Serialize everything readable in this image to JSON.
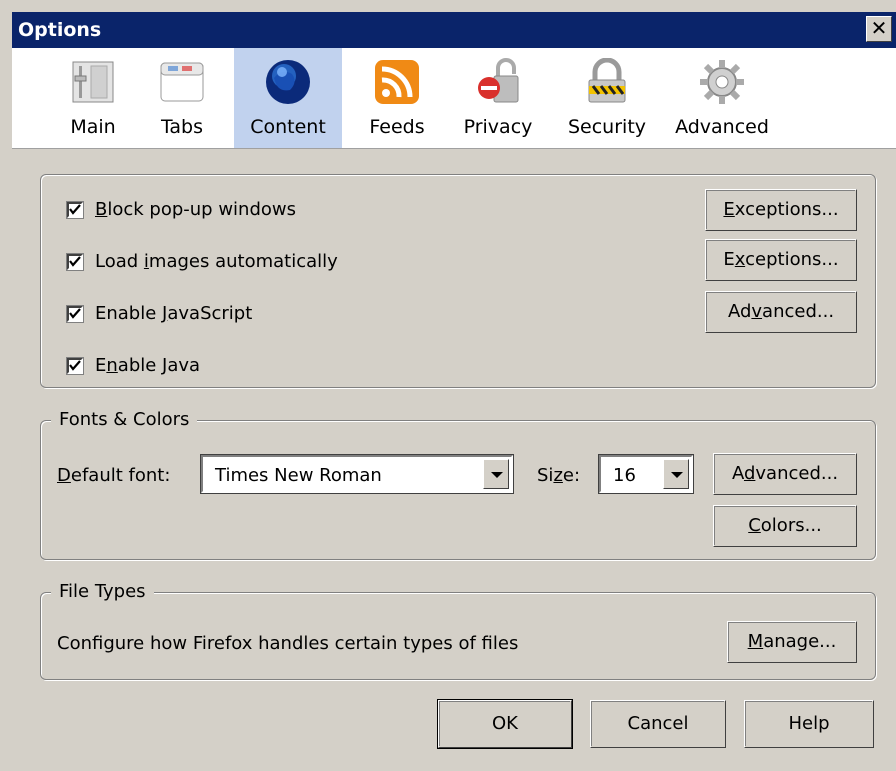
{
  "window": {
    "title": "Options",
    "close_glyph": "✕"
  },
  "toolbar": {
    "tabs": [
      {
        "label": "Main",
        "icon": "main-sliders-icon"
      },
      {
        "label": "Tabs",
        "icon": "tabs-window-icon"
      },
      {
        "label": "Content",
        "icon": "content-globe-icon",
        "selected": true
      },
      {
        "label": "Feeds",
        "icon": "feeds-rss-icon"
      },
      {
        "label": "Privacy",
        "icon": "privacy-lock-icon"
      },
      {
        "label": "Security",
        "icon": "security-padlock-icon"
      },
      {
        "label": "Advanced",
        "icon": "advanced-gear-icon"
      }
    ]
  },
  "content": {
    "block_popups": {
      "pre": "",
      "key": "B",
      "post": "lock pop-up windows",
      "checked": true
    },
    "load_images": {
      "pre": "Load ",
      "key": "i",
      "post": "mages automatically",
      "checked": true
    },
    "enable_js": {
      "pre": "Enable ",
      "key": "J",
      "post": "avaScript",
      "checked": true
    },
    "enable_java": {
      "pre": "E",
      "key": "n",
      "post": "able Java",
      "checked": true
    },
    "exceptions1": {
      "pre": "",
      "key": "E",
      "post": "xceptions..."
    },
    "exceptions2": {
      "pre": "E",
      "key": "x",
      "post": "ceptions..."
    },
    "advanced_js": {
      "pre": "Ad",
      "key": "v",
      "post": "anced..."
    }
  },
  "fonts": {
    "legend": "Fonts & Colors",
    "default_font_label": {
      "pre": "",
      "key": "D",
      "post": "efault font:"
    },
    "default_font_value": "Times New Roman",
    "size_label": {
      "pre": "Si",
      "key": "z",
      "post": "e:"
    },
    "size_value": "16",
    "advanced_btn": {
      "pre": "A",
      "key": "d",
      "post": "vanced..."
    },
    "colors_btn": {
      "pre": "",
      "key": "C",
      "post": "olors..."
    }
  },
  "filetypes": {
    "legend": "File Types",
    "description": "Configure how Firefox handles certain types of files",
    "manage_btn": {
      "pre": "",
      "key": "M",
      "post": "anage..."
    }
  },
  "footer": {
    "ok": "OK",
    "cancel": "Cancel",
    "help": "Help"
  }
}
